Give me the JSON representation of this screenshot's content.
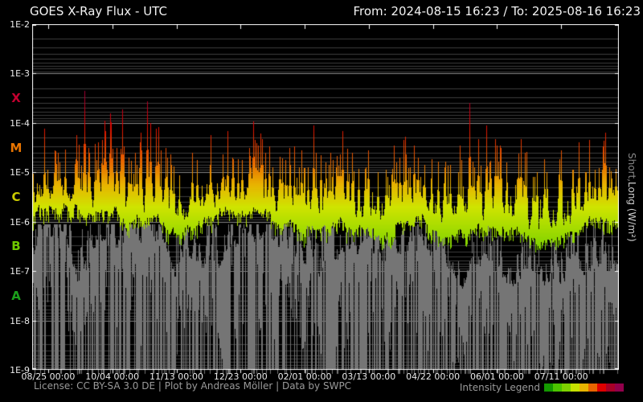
{
  "header": {
    "title": "GOES X-Ray Flux - UTC",
    "range_label": "From: 2024-08-15 16:23  /  To: 2025-08-16 16:23"
  },
  "right_axis": {
    "short_label": "Short,",
    "long_label": " Long (W/m²)",
    "short_color": "#8a8a8a",
    "long_color": "#cfcfcf"
  },
  "footer": {
    "license": "License: CC BY-SA 3.0 DE | Plot by Andreas Möller | Data by SWPC",
    "legend_label": "Intensity Legend",
    "legend_colors": [
      "#149800",
      "#4cc400",
      "#7ed200",
      "#c6e200",
      "#e8b400",
      "#e86400",
      "#de0000",
      "#a80027",
      "#92004b"
    ]
  },
  "chart_data": {
    "type": "line",
    "title": "GOES X-Ray Flux - UTC",
    "time_start": "2024-08-15 16:23",
    "time_end": "2025-08-16 16:23",
    "x_range_days": [
      0,
      366
    ],
    "ylog_range": [
      -9,
      -2
    ],
    "ylabel_right": "Short, Long (W/m²)",
    "grid": {
      "minor_color": "#3d3d3d",
      "major_color": "#878787",
      "frame_color": "#ffffff"
    },
    "y_ticks": [
      {
        "label": "1E-2",
        "log": -2
      },
      {
        "label": "1E-3",
        "log": -3
      },
      {
        "label": "1E-4",
        "log": -4
      },
      {
        "label": "1E-5",
        "log": -5
      },
      {
        "label": "1E-6",
        "log": -6
      },
      {
        "label": "1E-7",
        "log": -7
      },
      {
        "label": "1E-8",
        "log": -8
      },
      {
        "label": "1E-9",
        "log": -9
      }
    ],
    "x_ticks": [
      {
        "label": "08/25 00:00",
        "day": 10
      },
      {
        "label": "10/04 00:00",
        "day": 50
      },
      {
        "label": "11/13 00:00",
        "day": 90
      },
      {
        "label": "12/23 00:00",
        "day": 130
      },
      {
        "label": "02/01 00:00",
        "day": 170
      },
      {
        "label": "03/13 00:00",
        "day": 210
      },
      {
        "label": "04/22 00:00",
        "day": 250
      },
      {
        "label": "06/01 00:00",
        "day": 290
      },
      {
        "label": "07/11 00:00",
        "day": 330
      }
    ],
    "flare_classes": [
      {
        "label": "X",
        "log_center": -3.5,
        "color": "#c4002f"
      },
      {
        "label": "M",
        "log_center": -4.5,
        "color": "#e87400"
      },
      {
        "label": "C",
        "log_center": -5.5,
        "color": "#cccc00"
      },
      {
        "label": "B",
        "log_center": -6.5,
        "color": "#6ec800"
      },
      {
        "label": "A",
        "log_center": -7.5,
        "color": "#1ca01c"
      }
    ],
    "colormap": [
      [
        -8.6,
        "#0e8f00"
      ],
      [
        -7.3,
        "#3fbc00"
      ],
      [
        -6.6,
        "#77d000"
      ],
      [
        -6.1,
        "#a8dc00"
      ],
      [
        -5.7,
        "#cfe400"
      ],
      [
        -5.25,
        "#e8b400"
      ],
      [
        -4.8,
        "#e86a00"
      ],
      [
        -4.35,
        "#e03000"
      ],
      [
        -4.0,
        "#dc0000"
      ],
      [
        -3.55,
        "#a80027"
      ],
      [
        -3.1,
        "#92004b"
      ]
    ],
    "series": [
      {
        "name": "Long",
        "unit": "W/m2",
        "style": "intensity-colored",
        "sample_step_days": 10,
        "log10_flux": [
          -5.61,
          -5.58,
          -5.55,
          -5.61,
          -5.66,
          -5.61,
          -5.78,
          -5.66,
          -5.74,
          -6.12,
          -5.87,
          -5.78,
          -5.66,
          -5.61,
          -5.55,
          -5.71,
          -5.87,
          -5.99,
          -6.04,
          -5.82,
          -5.91,
          -5.94,
          -6.15,
          -5.91,
          -5.78,
          -5.94,
          -6.15,
          -5.99,
          -5.91,
          -6.04,
          -5.94,
          -6.23,
          -6.27,
          -6.15,
          -5.94,
          -5.71,
          -5.91,
          -5.99
        ]
      },
      {
        "name": "Short",
        "unit": "W/m2",
        "style": "gray-band",
        "color": "#757575",
        "sample_step_days": 10,
        "log10_flux_envelope": [
          -6.5,
          -6.25,
          -6.2,
          -7.3,
          -6.35,
          -6.25,
          -6.3,
          -6.35,
          -6.3,
          -7.0,
          -6.7,
          -6.9,
          -6.6,
          -6.35,
          -6.2,
          -6.5,
          -6.6,
          -6.75,
          -7.0,
          -6.5,
          -6.55,
          -6.6,
          -6.85,
          -6.6,
          -6.45,
          -6.7,
          -7.1,
          -7.2,
          -6.75,
          -7.0,
          -7.3,
          -7.1,
          -7.35,
          -7.1,
          -7.0,
          -6.9,
          -7.05,
          -7.0
        ]
      }
    ],
    "flares": [
      {
        "day": 14,
        "log10_peak": -4.55
      },
      {
        "day": 17,
        "log10_peak": -4.8
      },
      {
        "day": 32.5,
        "log10_peak": -3.35
      },
      {
        "day": 35.5,
        "log10_peak": -4.6
      },
      {
        "day": 41,
        "log10_peak": -4.4
      },
      {
        "day": 45,
        "log10_peak": -3.95
      },
      {
        "day": 48.5,
        "log10_peak": -3.8
      },
      {
        "day": 52.5,
        "log10_peak": -4.5
      },
      {
        "day": 56,
        "log10_peak": -3.73
      },
      {
        "day": 60,
        "log10_peak": -4.7
      },
      {
        "day": 65,
        "log10_peak": -4.85
      },
      {
        "day": 71.5,
        "log10_peak": -3.57
      },
      {
        "day": 73.5,
        "log10_peak": -4.0
      },
      {
        "day": 78.5,
        "log10_peak": -4.08
      },
      {
        "day": 83,
        "log10_peak": -4.5
      },
      {
        "day": 86.5,
        "log10_peak": -4.85
      },
      {
        "day": 100,
        "log10_peak": -4.6
      },
      {
        "day": 103,
        "log10_peak": -4.75
      },
      {
        "day": 111,
        "log10_peak": -4.85
      },
      {
        "day": 119,
        "log10_peak": -4.9
      },
      {
        "day": 125,
        "log10_peak": -4.7
      },
      {
        "day": 131,
        "log10_peak": -4.75
      },
      {
        "day": 135.5,
        "log10_peak": -4.5
      },
      {
        "day": 138,
        "log10_peak": -3.97
      },
      {
        "day": 139,
        "log10_peak": -4.35
      },
      {
        "day": 141,
        "log10_peak": -4.45
      },
      {
        "day": 150,
        "log10_peak": -4.9
      },
      {
        "day": 158,
        "log10_peak": -4.75
      },
      {
        "day": 161,
        "log10_peak": -4.85
      },
      {
        "day": 168,
        "log10_peak": -4.55
      },
      {
        "day": 172,
        "log10_peak": -4.9
      },
      {
        "day": 175.5,
        "log10_peak": -4.05
      },
      {
        "day": 183,
        "log10_peak": -4.8
      },
      {
        "day": 189.5,
        "log10_peak": -4.9
      },
      {
        "day": 196.5,
        "log10_peak": -4.52
      },
      {
        "day": 199.5,
        "log10_peak": -4.6
      },
      {
        "day": 208,
        "log10_peak": -4.9
      },
      {
        "day": 215.5,
        "log10_peak": -5.0
      },
      {
        "day": 220.5,
        "log10_peak": -4.95
      },
      {
        "day": 225.5,
        "log10_peak": -4.45
      },
      {
        "day": 229,
        "log10_peak": -4.7
      },
      {
        "day": 235.5,
        "log10_peak": -4.9
      },
      {
        "day": 240.5,
        "log10_peak": -4.7
      },
      {
        "day": 244.5,
        "log10_peak": -4.85
      },
      {
        "day": 253,
        "log10_peak": -4.78
      },
      {
        "day": 257,
        "log10_peak": -4.9
      },
      {
        "day": 260.5,
        "log10_peak": -4.85
      },
      {
        "day": 265.5,
        "log10_peak": -5.0
      },
      {
        "day": 272.5,
        "log10_peak": -3.59
      },
      {
        "day": 276,
        "log10_peak": -4.9
      },
      {
        "day": 283.5,
        "log10_peak": -4.05
      },
      {
        "day": 289,
        "log10_peak": -4.32
      },
      {
        "day": 292,
        "log10_peak": -4.45
      },
      {
        "day": 296,
        "log10_peak": -4.8
      },
      {
        "day": 305,
        "log10_peak": -4.32
      },
      {
        "day": 307.5,
        "log10_peak": -4.6
      },
      {
        "day": 313.5,
        "log10_peak": -5.1
      },
      {
        "day": 321,
        "log10_peak": -5.0
      },
      {
        "day": 328.5,
        "log10_peak": -5.05
      },
      {
        "day": 337.5,
        "log10_peak": -4.95
      },
      {
        "day": 345,
        "log10_peak": -5.0
      },
      {
        "day": 351,
        "log10_peak": -4.95
      },
      {
        "day": 353.5,
        "log10_peak": -4.92
      },
      {
        "day": 357,
        "log10_peak": -4.82
      },
      {
        "day": 360,
        "log10_peak": -4.9
      }
    ]
  }
}
